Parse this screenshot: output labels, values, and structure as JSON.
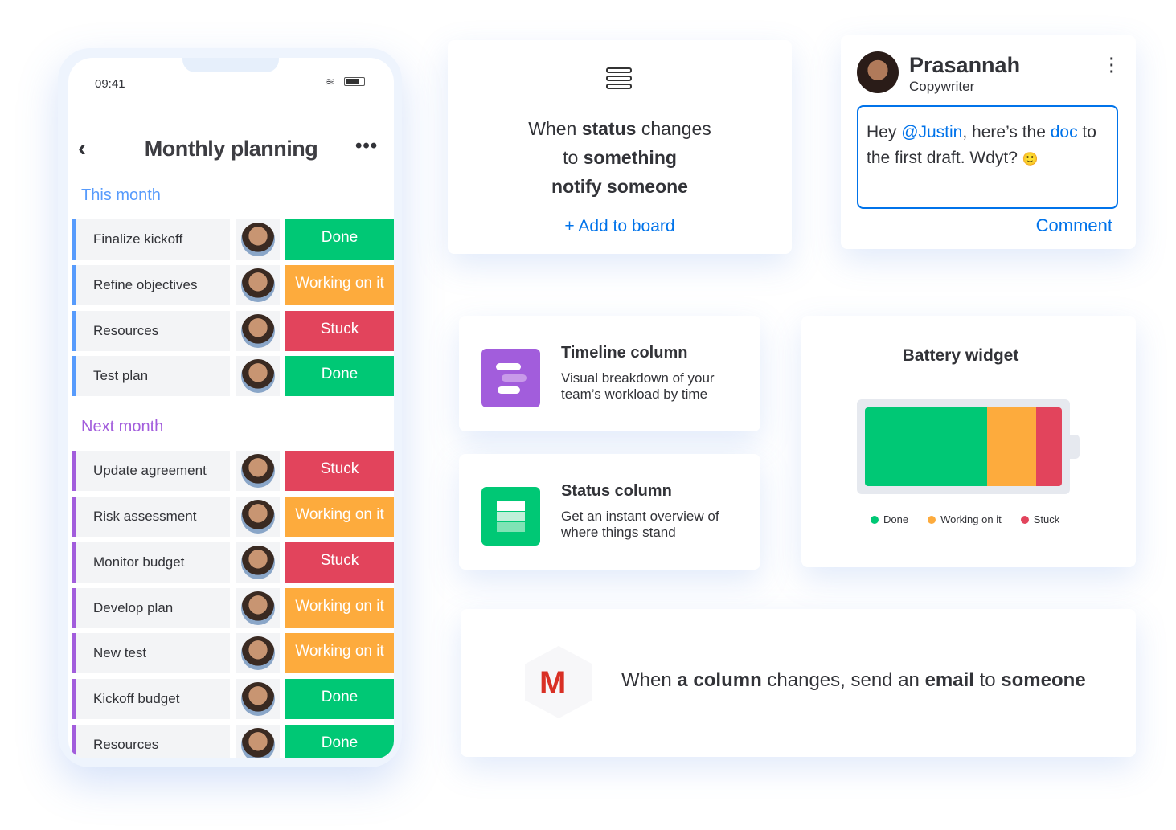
{
  "phone": {
    "time": "09:41",
    "title": "Monthly planning",
    "groups": [
      {
        "label": "This month",
        "color": "#579bfc",
        "rows": [
          {
            "name": "Finalize kickoff",
            "status": "Done"
          },
          {
            "name": "Refine objectives",
            "status": "Working on it"
          },
          {
            "name": "Resources",
            "status": "Stuck"
          },
          {
            "name": "Test plan",
            "status": "Done"
          }
        ]
      },
      {
        "label": "Next month",
        "color": "#a25ddc",
        "rows": [
          {
            "name": "Update agreement",
            "status": "Stuck"
          },
          {
            "name": "Risk assessment",
            "status": "Working on it"
          },
          {
            "name": "Monitor budget",
            "status": "Stuck"
          },
          {
            "name": "Develop plan",
            "status": "Working on it"
          },
          {
            "name": "New test",
            "status": "Working on it"
          },
          {
            "name": "Kickoff budget",
            "status": "Done"
          },
          {
            "name": "Resources",
            "status": "Done"
          }
        ]
      }
    ]
  },
  "status_colors": {
    "Done": "#00c875",
    "Working on it": "#fdab3d",
    "Stuck": "#e2445c"
  },
  "automation": {
    "l1a": "When ",
    "l1b": "status",
    "l1c": " changes",
    "l2a": "to ",
    "l2b": "something",
    "l3": "notify someone",
    "add": "+ Add to board"
  },
  "comment": {
    "name": "Prasannah",
    "role": "Copywriter",
    "t1": "Hey ",
    "mention": "@Justin",
    "t2": ", here’s the ",
    "link": "doc",
    "t3": " to the first draft. Wdyt? ",
    "emoji": "🙂",
    "button": "Comment"
  },
  "timeline": {
    "title": "Timeline column",
    "desc": "Visual breakdown of your team’s workload by time"
  },
  "statuscol": {
    "title": "Status column",
    "desc": "Get an instant overview of where things stand"
  },
  "battery": {
    "title": "Battery widget",
    "segments": [
      {
        "label": "Done",
        "percent": 62,
        "color": "#00c875"
      },
      {
        "label": "Working on it",
        "percent": 25,
        "color": "#fdab3d"
      },
      {
        "label": "Stuck",
        "percent": 13,
        "color": "#e2445c"
      }
    ]
  },
  "email": {
    "a": "When ",
    "b": "a column",
    "c": " changes, send an ",
    "d": "email",
    "e": " to ",
    "f": "someone"
  }
}
